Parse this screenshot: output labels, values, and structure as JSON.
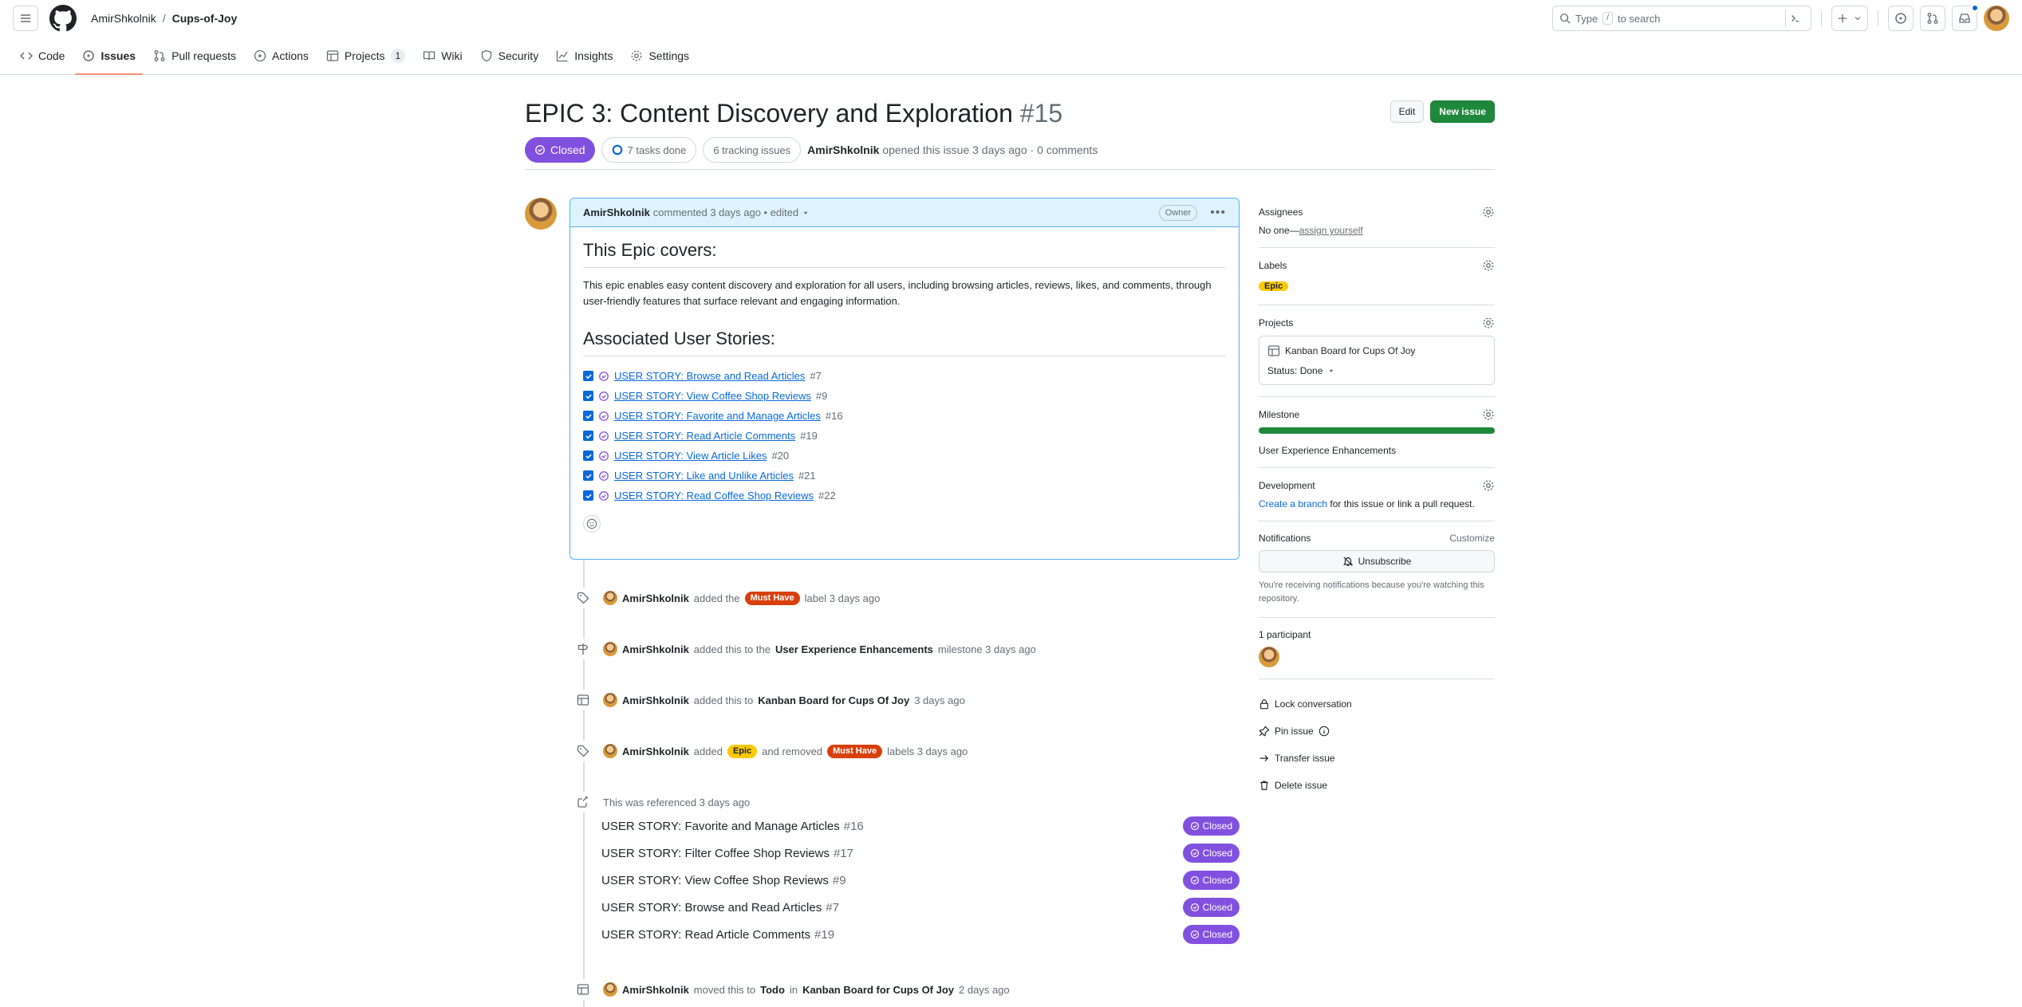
{
  "header": {
    "owner": "AmirShkolnik",
    "separator": "/",
    "repo": "Cups-of-Joy",
    "search_prefix": "Type",
    "search_key": "/",
    "search_suffix": "to search"
  },
  "nav": {
    "tabs": [
      {
        "label": "Code"
      },
      {
        "label": "Issues"
      },
      {
        "label": "Pull requests"
      },
      {
        "label": "Actions"
      },
      {
        "label": "Projects",
        "count": "1"
      },
      {
        "label": "Wiki"
      },
      {
        "label": "Security"
      },
      {
        "label": "Insights"
      },
      {
        "label": "Settings"
      }
    ]
  },
  "issue": {
    "title": "EPIC 3: Content Discovery and Exploration",
    "number": "#15",
    "edit_label": "Edit",
    "new_issue_label": "New issue",
    "state": "Closed",
    "tasks_done": "7 tasks done",
    "tracking": "6 tracking issues",
    "author": "AmirShkolnik",
    "opened_text": "opened this issue 3 days ago · 0 comments"
  },
  "comment": {
    "author": "AmirShkolnik",
    "meta": "commented 3 days ago • edited",
    "owner_badge": "Owner",
    "heading1": "This Epic covers:",
    "paragraph": "This epic enables easy content discovery and exploration for all users, including browsing articles, reviews, likes, and comments, through user-friendly features that surface relevant and engaging information.",
    "heading2": "Associated User Stories:",
    "tasks": [
      {
        "title": "USER STORY: Browse and Read Articles",
        "num": "#7"
      },
      {
        "title": "USER STORY: View Coffee Shop Reviews",
        "num": "#9"
      },
      {
        "title": "USER STORY: Favorite and Manage Articles",
        "num": "#16"
      },
      {
        "title": "USER STORY: Read Article Comments",
        "num": "#19"
      },
      {
        "title": "USER STORY: View Article Likes",
        "num": "#20"
      },
      {
        "title": "USER STORY: Like and Unlike Articles",
        "num": "#21"
      },
      {
        "title": "USER STORY: Read Coffee Shop Reviews",
        "num": "#22"
      }
    ]
  },
  "timeline": {
    "e1": {
      "author": "AmirShkolnik",
      "pre": "added the",
      "label": "Must Have",
      "post": "label 3 days ago"
    },
    "e2": {
      "author": "AmirShkolnik",
      "pre": "added this to the",
      "target": "User Experience Enhancements",
      "post": "milestone 3 days ago"
    },
    "e3": {
      "author": "AmirShkolnik",
      "pre": "added this to",
      "target": "Kanban Board for Cups Of Joy",
      "post": "3 days ago"
    },
    "e4": {
      "author": "AmirShkolnik",
      "pre": "added",
      "label1": "Epic",
      "mid": "and removed",
      "label2": "Must Have",
      "post": "labels 3 days ago"
    },
    "ref_header": "This was referenced 3 days ago",
    "refs": [
      {
        "title": "USER STORY: Favorite and Manage Articles",
        "num": "#16",
        "state": "Closed"
      },
      {
        "title": "USER STORY: Filter Coffee Shop Reviews",
        "num": "#17",
        "state": "Closed"
      },
      {
        "title": "USER STORY: View Coffee Shop Reviews",
        "num": "#9",
        "state": "Closed"
      },
      {
        "title": "USER STORY: Browse and Read Articles",
        "num": "#7",
        "state": "Closed"
      },
      {
        "title": "USER STORY: Read Article Comments",
        "num": "#19",
        "state": "Closed"
      }
    ],
    "e5": {
      "author": "AmirShkolnik",
      "pre": "moved this to",
      "col": "Todo",
      "mid": "in",
      "target": "Kanban Board for Cups Of Joy",
      "post": "2 days ago"
    }
  },
  "sidebar": {
    "assignees_title": "Assignees",
    "assignees_none": "No one—",
    "assign_yourself": "assign yourself",
    "labels_title": "Labels",
    "label": "Epic",
    "projects_title": "Projects",
    "project_name": "Kanban Board for Cups Of Joy",
    "project_status": "Status: Done",
    "milestone_title": "Milestone",
    "milestone_progress": 1.0,
    "milestone_name": "User Experience Enhancements",
    "development_title": "Development",
    "create_branch": "Create a branch",
    "development_text": "for this issue or link a pull request.",
    "notifications_title": "Notifications",
    "customize": "Customize",
    "unsubscribe": "Unsubscribe",
    "notif_text": "You're receiving notifications because you're watching this repository.",
    "participants": "1 participant",
    "lock": "Lock conversation",
    "pin": "Pin issue",
    "transfer": "Transfer issue",
    "delete": "Delete issue"
  },
  "colors": {
    "closed": "#8250df",
    "must_have": "#d93f0b",
    "epic": "#fbca04",
    "primary": "#1f883d",
    "link": "#0969da"
  }
}
